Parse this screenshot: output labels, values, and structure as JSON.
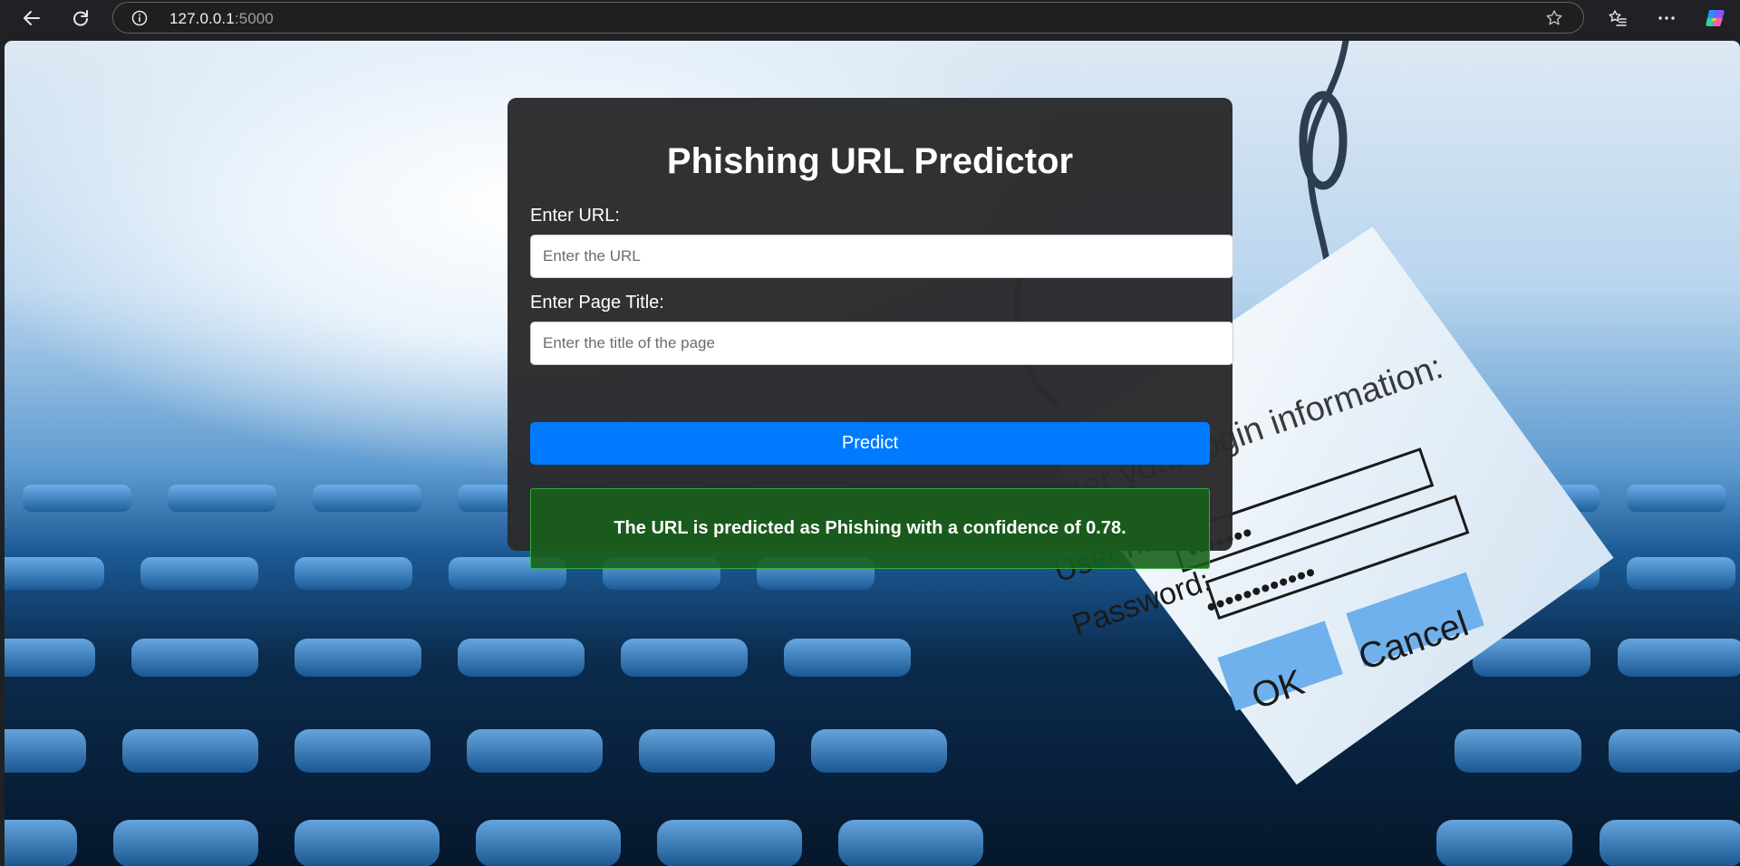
{
  "browser": {
    "address": {
      "host": "127.0.0.1",
      "port": ":5000"
    },
    "icons": {
      "back": "back-arrow-icon",
      "refresh": "refresh-icon",
      "site_info": "info-icon",
      "favorite": "star-icon",
      "favorites": "favorites-icon",
      "more": "more-icon",
      "copilot": "copilot-icon"
    }
  },
  "page": {
    "title": "Phishing URL Predictor",
    "url_field": {
      "label": "Enter URL:",
      "placeholder": "Enter the URL",
      "value": ""
    },
    "title_field": {
      "label": "Enter Page Title:",
      "placeholder": "Enter the title of the page",
      "value": ""
    },
    "predict_label": "Predict",
    "result": "The URL is predicted as Phishing with a confidence of 0.78."
  },
  "background_art": {
    "prompt_line": "Enter your login information:",
    "user_label": "User name:",
    "password_label": "Password:",
    "masked_user": "•••••••",
    "masked_password": "••••••••••••",
    "ok_label": "OK",
    "cancel_label": "Cancel"
  },
  "colors": {
    "card": "#2a2a2c",
    "predict_button": "#007bff",
    "result_bg": "#18601c",
    "result_border": "#2fae3a",
    "chrome": "#202124"
  }
}
